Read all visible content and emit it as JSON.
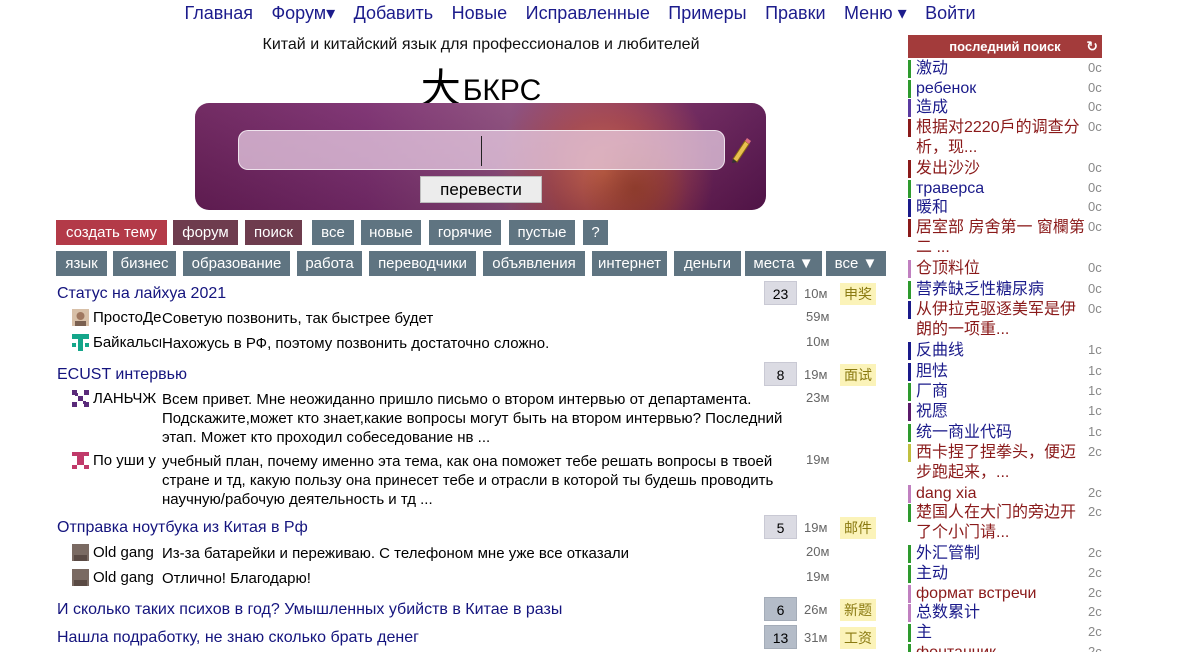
{
  "nav": {
    "items": [
      "Главная",
      "Форум▾",
      "Добавить",
      "Новые",
      "Исправленные",
      "Примеры",
      "Правки",
      "Меню ▾",
      "Войти"
    ]
  },
  "header": {
    "subtitle": "Китай и китайский язык для профессионалов и любителей",
    "logo_glyph": "大",
    "logo_name": "БКРС"
  },
  "search": {
    "value": "",
    "button": "перевести"
  },
  "forum_buttons": {
    "row1": [
      "создать тему",
      "форум",
      "поиск",
      "все",
      "новые",
      "горячие",
      "пустые",
      "?"
    ],
    "row2": [
      "язык",
      "бизнес",
      "образование",
      "работа",
      "переводчики",
      "объявления",
      "интернет",
      "деньги",
      "места ▼",
      "все ▼"
    ]
  },
  "threads": [
    {
      "title": "Статус на лайхуа 2021",
      "count": "23",
      "time": "10м",
      "tag": "申奖",
      "replies": [
        {
          "name": "ПростоДе",
          "text": "Советую позвонить, так быстрее будет",
          "time": "59м"
        },
        {
          "name": "Байкальск",
          "text": "Нахожусь в РФ, поэтому позвонить достаточно сложно.",
          "time": "10м"
        }
      ]
    },
    {
      "title": "ECUST интервью",
      "count": "8",
      "time": "19м",
      "tag": "面试",
      "replies": [
        {
          "name": "ЛАНЬЧЖ",
          "text": "Всем привет. Мне неожиданно пришло письмо о втором интервью от департамента. Подскажите,может кто знает,какие вопросы могут быть на втором интервью? Последний этап. Может кто проходил собеседование нв ...",
          "time": "23м"
        },
        {
          "name": "По уши у",
          "text": "учебный план, почему именно эта тема, как она поможет тебе решать вопросы в твоей стране и тд, какую пользу она принесет тебе и отрасли в которой ты будешь проводить научную/рабочую деятельность и тд ...",
          "time": "19м"
        }
      ]
    },
    {
      "title": "Отправка ноутбука из Китая в Рф",
      "count": "5",
      "time": "19м",
      "tag": "邮件",
      "replies": [
        {
          "name": "Old gang",
          "text": "Из-за батарейки и переживаю. С телефоном мне уже все отказали",
          "time": "20м"
        },
        {
          "name": "Old gang",
          "text": "Отлично! Благодарю!",
          "time": "19м"
        }
      ]
    },
    {
      "title": "И сколько таких психов в год? Умышленных убийств в Китае в разы",
      "count": "6",
      "time": "26м",
      "tag": "新题",
      "replies": []
    },
    {
      "title": "Нашла подработку, не знаю сколько брать денег",
      "count": "13",
      "time": "31м",
      "tag": "工资",
      "replies": []
    }
  ],
  "sidebar": {
    "title": "последний поиск",
    "refresh_icon": "refresh-icon",
    "items": [
      {
        "word": "激动",
        "time": "0с",
        "color": "#1a1a8a",
        "bar": "#2e9a2e"
      },
      {
        "word": "ребенок",
        "time": "0с",
        "color": "#1a1a8a",
        "bar": "#2e9a2e"
      },
      {
        "word": "造成",
        "time": "0с",
        "color": "#1a1a8a",
        "bar": "#5a3aa0"
      },
      {
        "word": "根据对2220戶的调查分析，现...",
        "time": "0с",
        "color": "#8a1a1a",
        "bar": "#8a1a1a"
      },
      {
        "word": "发出沙沙",
        "time": "0с",
        "color": "#8a1a1a",
        "bar": "#8a1a1a"
      },
      {
        "word": "траверса",
        "time": "0с",
        "color": "#1a1a8a",
        "bar": "#2e9a2e"
      },
      {
        "word": "暖和",
        "time": "0с",
        "color": "#1a1a8a",
        "bar": "#1a1a8a"
      },
      {
        "word": "居室部 房舍第一 窗欄第二 ...",
        "time": "0с",
        "color": "#8a1a1a",
        "bar": "#8a1a1a"
      },
      {
        "word": "仓顶料位",
        "time": "0с",
        "color": "#8a1a1a",
        "bar": "#c080c0"
      },
      {
        "word": "营养缺乏性糖尿病",
        "time": "0с",
        "color": "#1a1a8a",
        "bar": "#2e9a2e"
      },
      {
        "word": "从伊拉克驱逐美军是伊朗的一项重...",
        "time": "0с",
        "color": "#8a1a1a",
        "bar": "#1a1a8a"
      },
      {
        "word": "反曲线",
        "time": "1с",
        "color": "#1a1a8a",
        "bar": "#1a1a8a"
      },
      {
        "word": "胆怯",
        "time": "1с",
        "color": "#1a1a8a",
        "bar": "#1a1a8a"
      },
      {
        "word": "厂商",
        "time": "1с",
        "color": "#1a1a8a",
        "bar": "#2e9a2e"
      },
      {
        "word": "祝愿",
        "time": "1с",
        "color": "#1a1a8a",
        "bar": "#5a1a6a"
      },
      {
        "word": "统一商业代码",
        "time": "1с",
        "color": "#1a1a8a",
        "bar": "#2e9a2e"
      },
      {
        "word": "西卡捏了捏拳头，便迈步跑起来，...",
        "time": "2с",
        "color": "#8a1a1a",
        "bar": "#c0c040"
      },
      {
        "word": "dang xia",
        "time": "2с",
        "color": "#8a1a1a",
        "bar": "#c080c0"
      },
      {
        "word": "楚国人在大门的旁边开了个小门请...",
        "time": "2с",
        "color": "#8a1a1a",
        "bar": "#2e9a2e"
      },
      {
        "word": "外汇管制",
        "time": "2с",
        "color": "#1a1a8a",
        "bar": "#2e9a2e"
      },
      {
        "word": "主动",
        "time": "2с",
        "color": "#1a1a8a",
        "bar": "#2e9a2e"
      },
      {
        "word": "формат встречи",
        "time": "2с",
        "color": "#8a1a1a",
        "bar": "#c080c0"
      },
      {
        "word": "总数累计",
        "time": "2с",
        "color": "#1a1a8a",
        "bar": "#c080c0"
      },
      {
        "word": "主",
        "time": "2с",
        "color": "#1a1a8a",
        "bar": "#2e9a2e"
      },
      {
        "word": "фонтанчик",
        "time": "2с",
        "color": "#8a1a1a",
        "bar": "#2e9a2e"
      }
    ]
  }
}
